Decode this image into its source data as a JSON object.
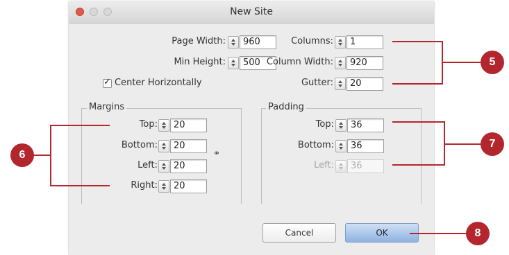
{
  "window": {
    "title": "New Site"
  },
  "page": {
    "width_label": "Page Width:",
    "width_value": "960",
    "min_height_label": "Min Height:",
    "min_height_value": "500",
    "center_label": "Center Horizontally",
    "center_checked": true
  },
  "columns": {
    "columns_label": "Columns:",
    "columns_value": "1",
    "col_width_label": "Column Width:",
    "col_width_value": "920",
    "gutter_label": "Gutter:",
    "gutter_value": "20"
  },
  "margins": {
    "title": "Margins",
    "top_label": "Top:",
    "top_value": "20",
    "bottom_label": "Bottom:",
    "bottom_value": "20",
    "left_label": "Left:",
    "left_value": "20",
    "right_label": "Right:",
    "right_value": "20",
    "link_icon": "chain-link-icon"
  },
  "padding": {
    "title": "Padding",
    "top_label": "Top:",
    "top_value": "36",
    "bottom_label": "Bottom:",
    "bottom_value": "36",
    "left_label": "Left:",
    "left_value": "36"
  },
  "buttons": {
    "cancel": "Cancel",
    "ok": "OK"
  },
  "callouts": {
    "c5": "5",
    "c6": "6",
    "c7": "7",
    "c8": "8"
  },
  "colors": {
    "callout": "#b3262d",
    "ok_button": "#8fb2e0"
  }
}
